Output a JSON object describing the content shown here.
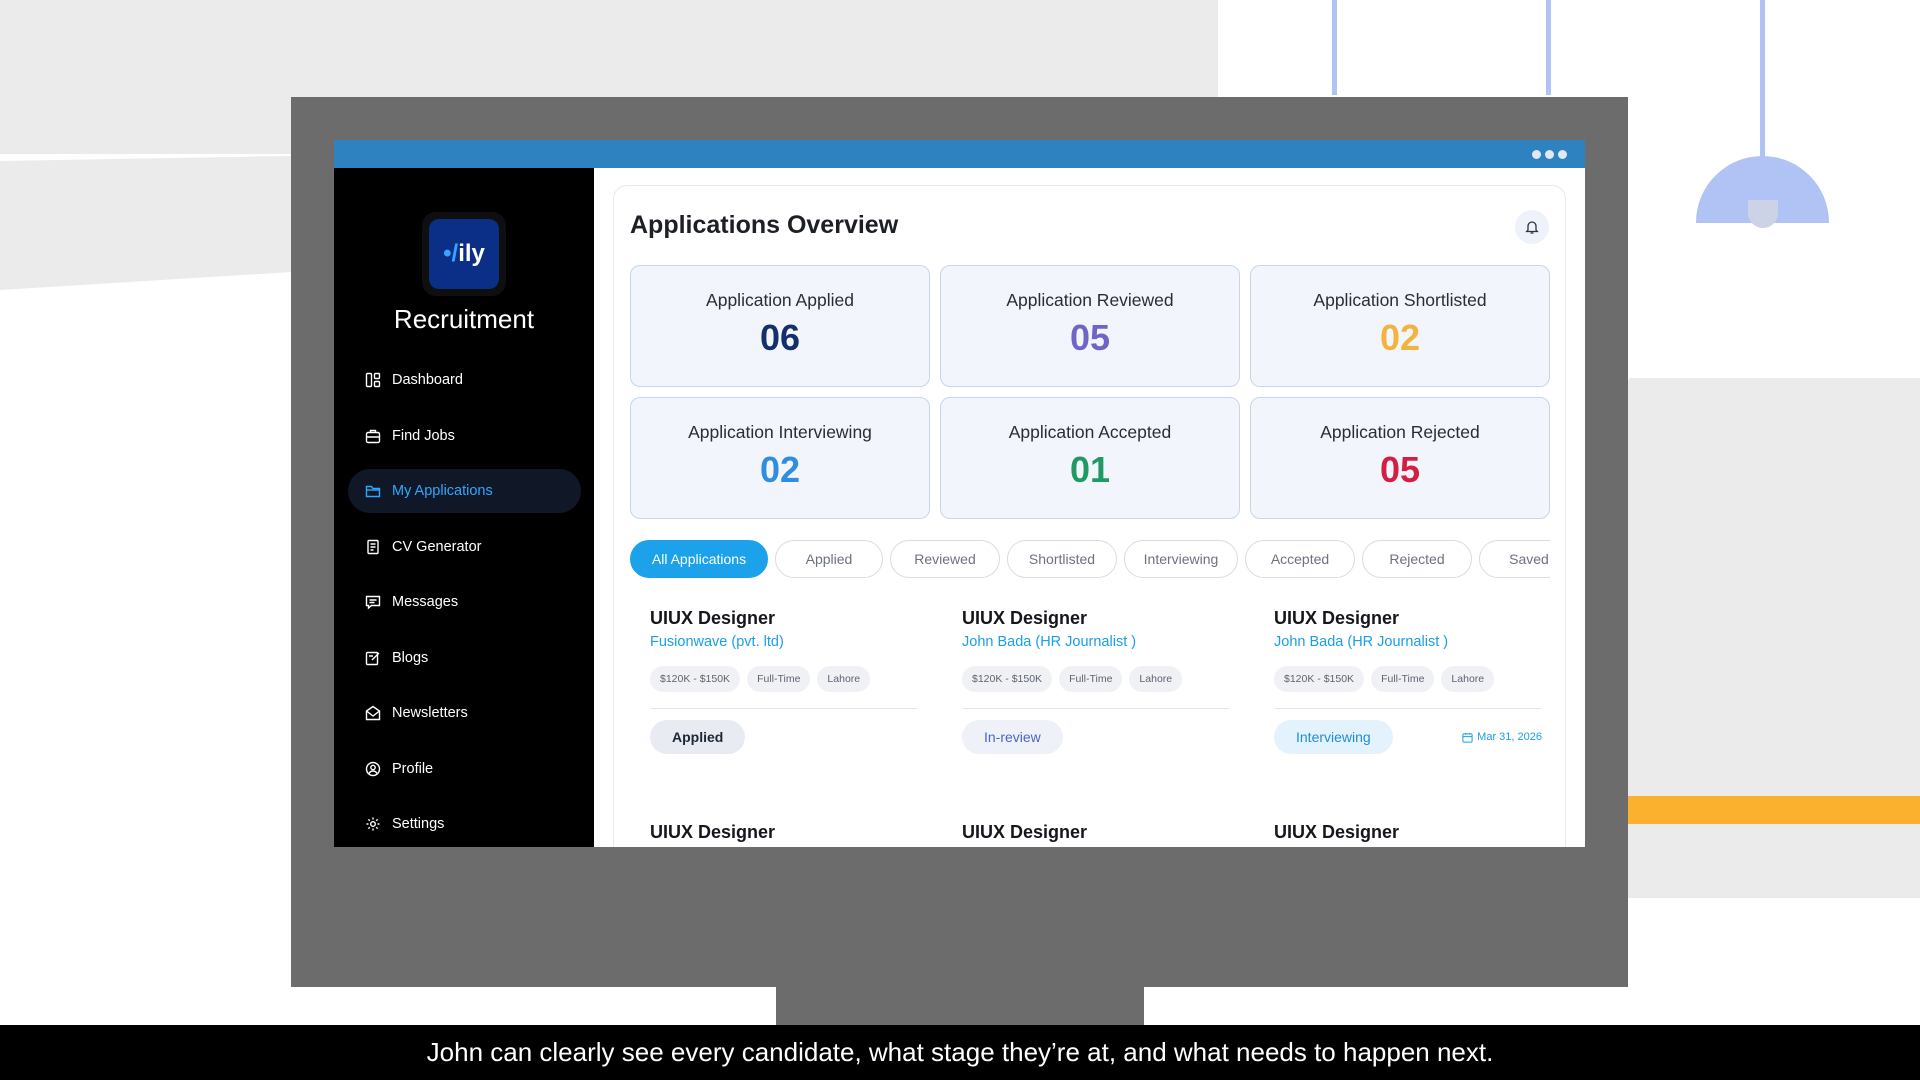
{
  "app": {
    "logo_text": "ily",
    "name": "Recruitment"
  },
  "sidebar": {
    "items": [
      {
        "label": "Dashboard",
        "icon": "dashboard-icon"
      },
      {
        "label": "Find Jobs",
        "icon": "briefcase-icon"
      },
      {
        "label": "My Applications",
        "icon": "folder-icon",
        "active": true
      },
      {
        "label": "CV Generator",
        "icon": "document-icon"
      },
      {
        "label": "Messages",
        "icon": "chat-icon"
      },
      {
        "label": "Blogs",
        "icon": "edit-icon"
      },
      {
        "label": "Newsletters",
        "icon": "mail-icon"
      },
      {
        "label": "Profile",
        "icon": "user-icon"
      },
      {
        "label": "Settings",
        "icon": "gear-icon"
      }
    ]
  },
  "main": {
    "title": "Applications Overview",
    "stats": [
      {
        "label": "Application Applied",
        "value": "06",
        "color": "#14306b"
      },
      {
        "label": "Application Reviewed",
        "value": "05",
        "color": "#7065c6"
      },
      {
        "label": "Application Shortlisted",
        "value": "02",
        "color": "#f2b441"
      },
      {
        "label": "Application Interviewing",
        "value": "02",
        "color": "#2f8ee0"
      },
      {
        "label": "Application Accepted",
        "value": "01",
        "color": "#1f9a63"
      },
      {
        "label": "Application Rejected",
        "value": "05",
        "color": "#d31f45"
      }
    ],
    "filters": [
      "All Applications",
      "Applied",
      "Reviewed",
      "Shortlisted",
      "Interviewing",
      "Accepted",
      "Rejected",
      "Saved"
    ],
    "cards": [
      {
        "title": "UIUX Designer",
        "company": "Fusionwave (pvt. ltd)",
        "tags": [
          "$120K - $150K",
          "Full-Time",
          "Lahore"
        ],
        "status": "Applied",
        "date": ""
      },
      {
        "title": "UIUX Designer",
        "company": "John Bada (HR Journalist )",
        "tags": [
          "$120K - $150K",
          "Full-Time",
          "Lahore"
        ],
        "status": "In-review",
        "date": ""
      },
      {
        "title": "UIUX Designer",
        "company": "John Bada (HR Journalist )",
        "tags": [
          "$120K - $150K",
          "Full-Time",
          "Lahore"
        ],
        "status": "Interviewing",
        "date": "Mar 31, 2026"
      }
    ],
    "cards_next": [
      "UIUX Designer",
      "UIUX Designer",
      "UIUX Designer"
    ]
  },
  "caption": "John can clearly see every candidate, what stage they’re at, and what needs to happen next.",
  "colors": {
    "accent": "#1ba2ea",
    "titlebar": "#2e82c0",
    "lamp": "#b1c3f5",
    "orange": "#fbb12e"
  }
}
